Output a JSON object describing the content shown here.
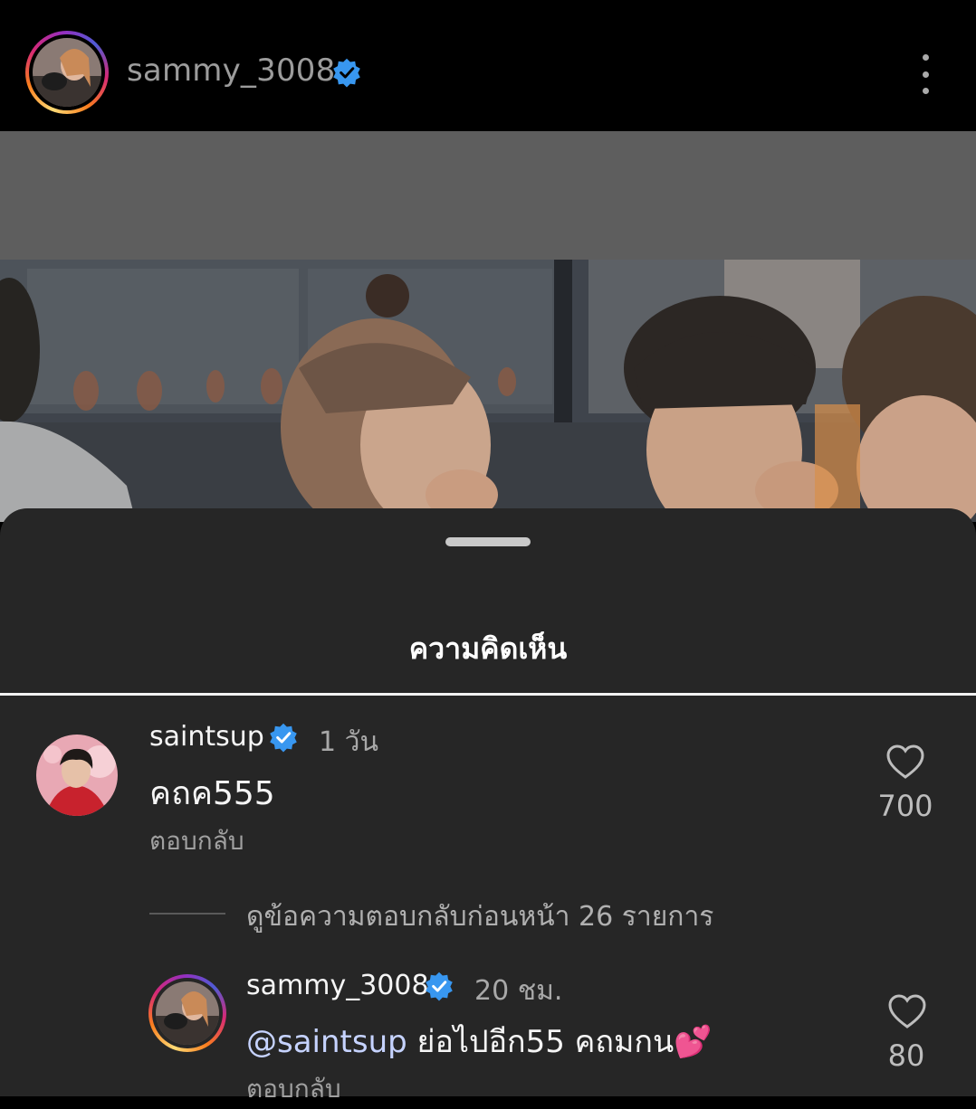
{
  "header": {
    "username": "sammy_3008",
    "verified_icon": "verified-badge-icon",
    "more_icon": "more-vertical-icon"
  },
  "sheet": {
    "title": "ความคิดเห็น"
  },
  "comments": [
    {
      "username": "saintsup",
      "time": "1 วัน",
      "text": "คถค555",
      "reply_label": "ตอบกลับ",
      "likes": "700"
    }
  ],
  "view_replies": "ดูข้อความตอบกลับก่อนหน้า 26 รายการ",
  "reply": {
    "username": "sammy_3008",
    "time": "20 ชม.",
    "mention": "@saintsup",
    "text": " ย่อไปอีก55 คถมกน💕",
    "reply_label": "ตอบกลับ",
    "likes": "80"
  },
  "colors": {
    "verified": "#3897f0",
    "background": "#000000",
    "sheet": "#262626",
    "mention": "#c6d3ff"
  }
}
